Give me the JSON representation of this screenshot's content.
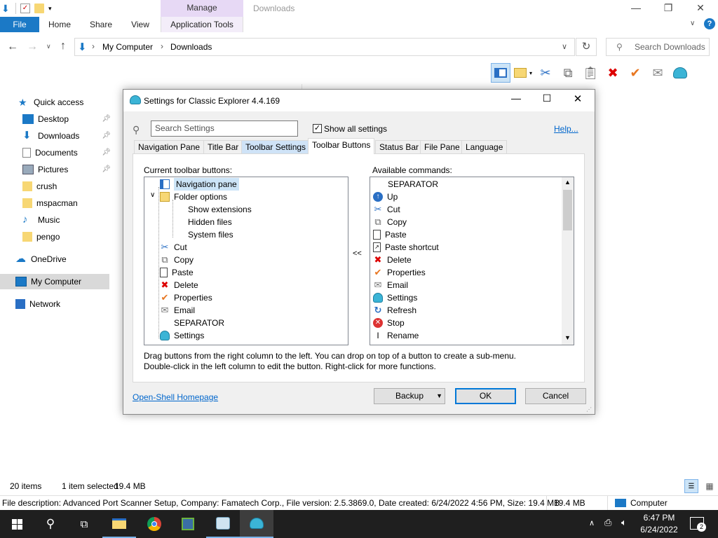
{
  "window": {
    "title": "Downloads",
    "manage_tab": "Manage"
  },
  "ribbon": {
    "tabs": [
      "File",
      "Home",
      "Share",
      "View",
      "Application Tools"
    ]
  },
  "address": {
    "path": [
      "My Computer",
      "Downloads"
    ],
    "search_placeholder": "Search Downloads"
  },
  "nav": {
    "quick_access": "Quick access",
    "items": [
      "Desktop",
      "Downloads",
      "Documents",
      "Pictures",
      "crush",
      "mspacman",
      "Music",
      "pengo"
    ],
    "onedrive": "OneDrive",
    "mycomputer": "My Computer",
    "network": "Network"
  },
  "status": {
    "items": "20 items",
    "selected": "1 item selected",
    "size": "19.4 MB"
  },
  "details": {
    "description": "File description: Advanced Port Scanner Setup, Company: Famatech Corp., File version: 2.5.3869.0, Date created: 6/24/2022 4:56 PM, Size: 19.4 MB",
    "size": "19.4 MB",
    "location": "Computer"
  },
  "dialog": {
    "title": "Settings for Classic Explorer 4.4.169",
    "search_placeholder": "Search Settings",
    "show_all": "Show all settings",
    "help": "Help...",
    "tabs": [
      "Navigation Pane",
      "Title Bar",
      "Toolbar Settings",
      "Toolbar Buttons",
      "Status Bar",
      "File Pane",
      "Language"
    ],
    "current_label": "Current toolbar buttons:",
    "available_label": "Available commands:",
    "current": [
      "Navigation pane",
      "Folder options",
      "Show extensions",
      "Hidden files",
      "System files",
      "Cut",
      "Copy",
      "Paste",
      "Delete",
      "Properties",
      "Email",
      "SEPARATOR",
      "Settings"
    ],
    "available": [
      "SEPARATOR",
      "Up",
      "Cut",
      "Copy",
      "Paste",
      "Paste shortcut",
      "Delete",
      "Properties",
      "Email",
      "Settings",
      "Refresh",
      "Stop",
      "Rename"
    ],
    "move_left": "<<",
    "hint1": "Drag buttons from the right column to the left. You can drop on top of a button to create a sub-menu.",
    "hint2": "Double-click in the left column to edit the button. Right-click for more functions.",
    "homepage": "Open-Shell Homepage",
    "backup": "Backup",
    "ok": "OK",
    "cancel": "Cancel"
  },
  "clock": {
    "time": "6:47 PM",
    "date": "6/24/2022",
    "notifications": "2"
  }
}
